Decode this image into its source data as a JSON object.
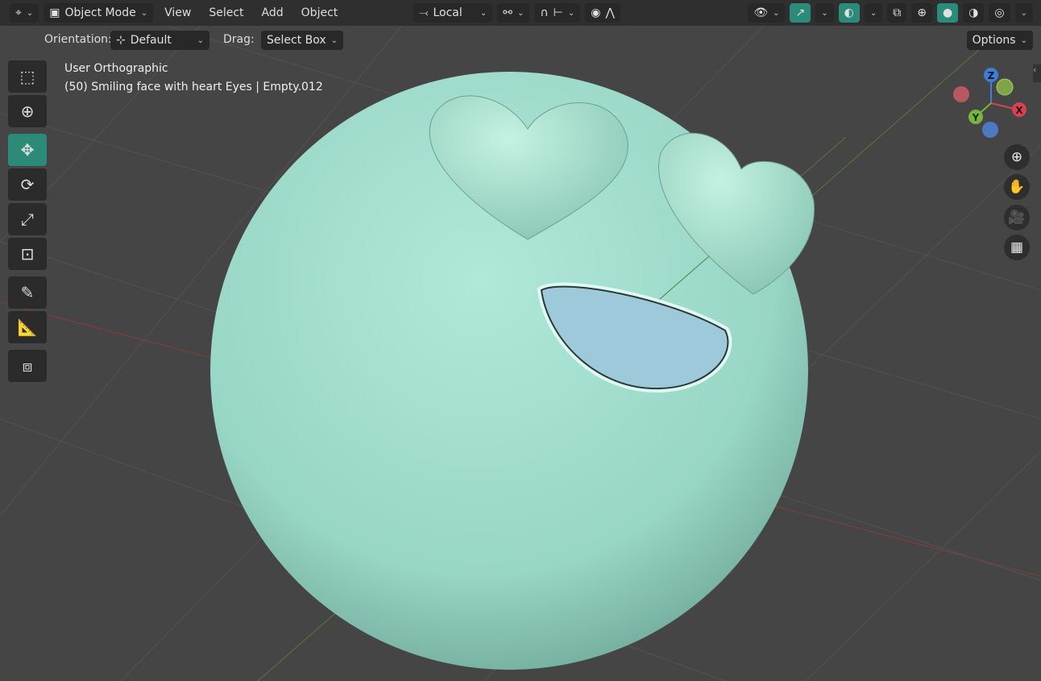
{
  "header": {
    "editor_icon": "viewport-editor-icon",
    "mode": "Object Mode",
    "menus": [
      "View",
      "Select",
      "Add",
      "Object"
    ],
    "transform_orientation": "Local",
    "shading_modes": [
      "wireframe",
      "solid",
      "material",
      "rendered"
    ],
    "active_shading": "solid"
  },
  "tool_settings": {
    "orientation_label": "Orientation:",
    "orientation_value": "Default",
    "drag_label": "Drag:",
    "drag_value": "Select Box",
    "options": "Options"
  },
  "overlay": {
    "view_name": "User Orthographic",
    "object_info": "(50) Smiling face with heart Eyes | Empty.012"
  },
  "toolbar": [
    "select-box",
    "cursor",
    "move",
    "rotate",
    "scale",
    "transform",
    "annotate",
    "measure",
    "add-cube"
  ],
  "active_tool": "move",
  "gizmo": {
    "x": "X",
    "y": "Y",
    "z": "Z"
  },
  "colors": {
    "accent": "#2c8a78",
    "object": "#a2dccd",
    "x_axis": "#d6424f",
    "y_axis": "#7cb33f",
    "z_axis": "#3d7fd6"
  }
}
